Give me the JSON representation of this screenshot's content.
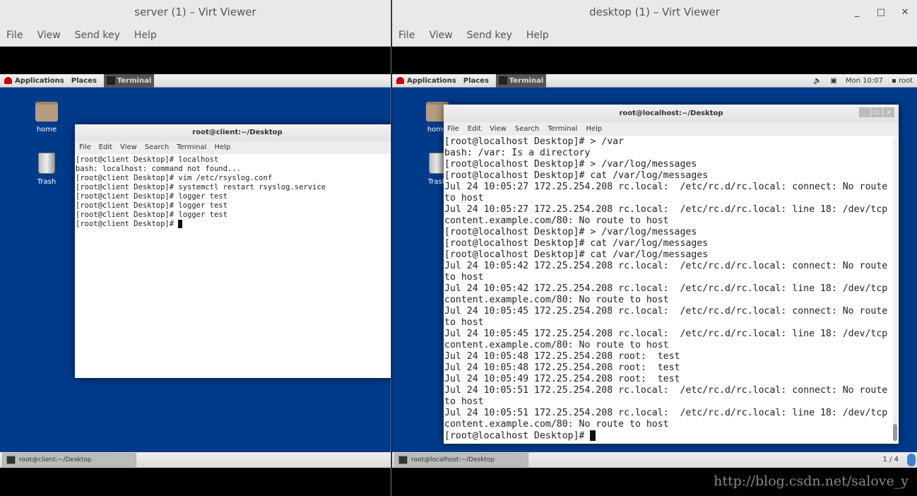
{
  "left_viewer": {
    "title": "server (1) – Virt Viewer",
    "menu": [
      "File",
      "View",
      "Send key",
      "Help"
    ],
    "topbar": {
      "applications": "Applications",
      "places": "Places",
      "task": "Terminal"
    },
    "desktop_icons": [
      "home",
      "Trash"
    ],
    "terminal": {
      "title": "root@client:~/Desktop",
      "menu": [
        "File",
        "Edit",
        "View",
        "Search",
        "Terminal",
        "Help"
      ],
      "lines": [
        "[root@client Desktop]# localhost",
        "bash: localhost: command not found...",
        "[root@client Desktop]# vim /etc/rsyslog.conf",
        "[root@client Desktop]# systemctl restart rsyslog.service",
        "[root@client Desktop]# logger test",
        "[root@client Desktop]# logger test",
        "[root@client Desktop]# logger test"
      ],
      "prompt": "[root@client Desktop]# "
    },
    "taskbar_item": "root@client:~/Desktop"
  },
  "right_viewer": {
    "title": "desktop (1) – Virt Viewer",
    "window_controls": [
      "_",
      "□",
      "✕"
    ],
    "menu": [
      "File",
      "View",
      "Send key",
      "Help"
    ],
    "topbar": {
      "applications": "Applications",
      "places": "Places",
      "task": "Terminal",
      "clock": "Mon 10:07",
      "user": "root",
      "icons": [
        "volume-icon",
        "network-icon",
        "user-icon"
      ]
    },
    "desktop_icons": [
      "home",
      "Trash"
    ],
    "terminal": {
      "title": "root@localhost:~/Desktop",
      "menu": [
        "File",
        "Edit",
        "View",
        "Search",
        "Terminal",
        "Help"
      ],
      "lines": [
        "[root@localhost Desktop]# > /var",
        "bash: /var: Is a directory",
        "[root@localhost Desktop]# > /var/log/messages",
        "[root@localhost Desktop]# cat /var/log/messages",
        "Jul 24 10:05:27 172.25.254.208 rc.local:  /etc/rc.d/rc.local: connect: No route",
        "to host",
        "Jul 24 10:05:27 172.25.254.208 rc.local:  /etc/rc.d/rc.local: line 18: /dev/tcp",
        "content.example.com/80: No route to host",
        "[root@localhost Desktop]# > /var/log/messages",
        "[root@localhost Desktop]# cat /var/log/messages",
        "[root@localhost Desktop]# cat /var/log/messages",
        "Jul 24 10:05:42 172.25.254.208 rc.local:  /etc/rc.d/rc.local: connect: No route",
        "to host",
        "Jul 24 10:05:42 172.25.254.208 rc.local:  /etc/rc.d/rc.local: line 18: /dev/tcp",
        "content.example.com/80: No route to host",
        "Jul 24 10:05:45 172.25.254.208 rc.local:  /etc/rc.d/rc.local: connect: No route",
        "to host",
        "Jul 24 10:05:45 172.25.254.208 rc.local:  /etc/rc.d/rc.local: line 18: /dev/tcp",
        "content.example.com/80: No route to host",
        "Jul 24 10:05:48 172.25.254.208 root:  test",
        "Jul 24 10:05:48 172.25.254.208 root:  test",
        "Jul 24 10:05:49 172.25.254.208 root:  test",
        "Jul 24 10:05:51 172.25.254.208 rc.local:  /etc/rc.d/rc.local: connect: No route",
        "to host",
        "Jul 24 10:05:51 172.25.254.208 rc.local:  /etc/rc.d/rc.local: line 18: /dev/tcp",
        "content.example.com/80: No route to host"
      ],
      "prompt": "[root@localhost Desktop]# "
    },
    "taskbar_item": "root@localhost:~/Desktop",
    "workspace": "1 / 4"
  },
  "watermark": "http://blog.csdn.net/salove_y"
}
